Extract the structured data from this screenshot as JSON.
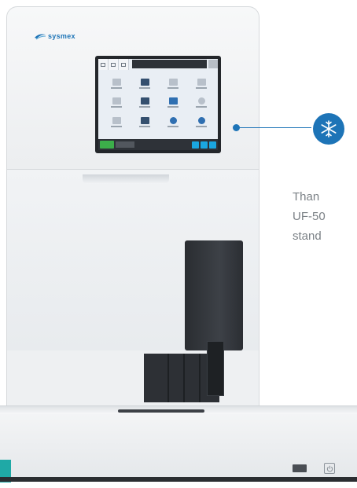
{
  "brand": {
    "logo_text": "sysmex",
    "color": "#1d74b7"
  },
  "callout": {
    "icon": "snowflake-icon",
    "lines": [
      "Than",
      "UF-50",
      "stand"
    ]
  },
  "colors": {
    "accent": "#1d74b7",
    "teal": "#1fa9a6",
    "ready": "#3cae4a",
    "screen_button": "#1aa6e0"
  },
  "controls": {
    "power_icon": "power-icon",
    "port_icon": "usb-port-icon"
  }
}
